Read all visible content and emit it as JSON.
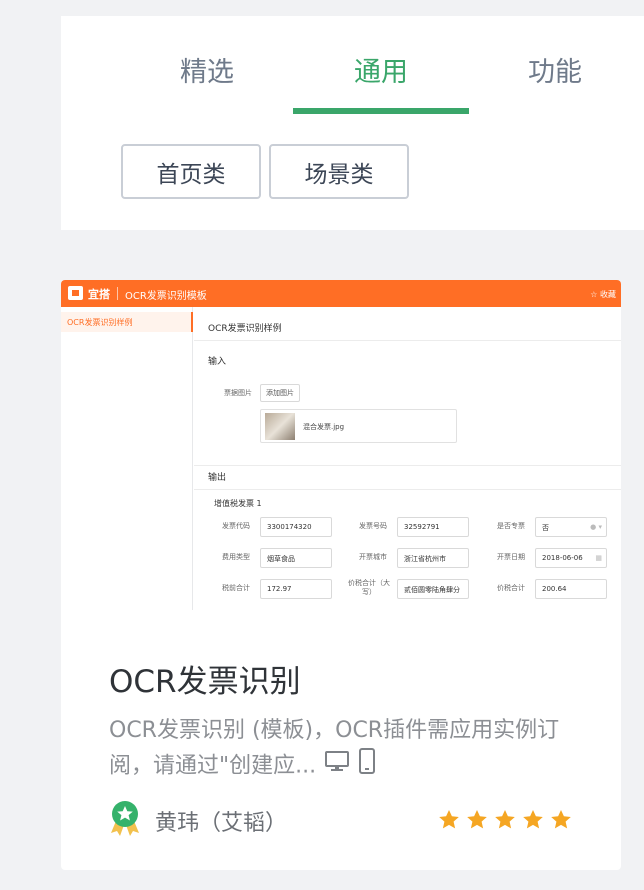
{
  "tabs": [
    {
      "label": "精选",
      "active": false
    },
    {
      "label": "通用",
      "active": true
    },
    {
      "label": "功能",
      "active": false
    }
  ],
  "chips": [
    "首页类",
    "场景类"
  ],
  "colors": {
    "accent": "#3aa66a",
    "preview_brand": "#ff6e25",
    "star": "#f5a623"
  },
  "card": {
    "preview": {
      "brand": "宜搭",
      "app_title": "OCR发票识别模板",
      "favorite": "☆ 收藏",
      "sidebar_item": "OCR发票识别样例",
      "page_heading": "OCR发票识别样例",
      "input_heading": "输入",
      "image_label": "票据图片",
      "add_image_button": "添加图片",
      "file_name": "混合发票.jpg",
      "output_heading": "输出",
      "invoice_heading": "增值税发票 1",
      "fields": {
        "code_label": "发票代码",
        "code_value": "3300174320",
        "number_label": "发票号码",
        "number_value": "32592791",
        "special_label": "是否专票",
        "special_value": "否",
        "type_label": "费用类型",
        "type_value": "烟草食品",
        "city_label": "开票城市",
        "city_value": "浙江省杭州市",
        "date_label": "开票日期",
        "date_value": "2018-06-06",
        "pretax_label": "税前合计",
        "pretax_value": "172.97",
        "total_cn_label": "价税合计（大写）",
        "total_cn_value": "贰佰圆零陆角肆分",
        "total_label": "价税合计",
        "total_value": "200.64"
      }
    },
    "title": "OCR发票识别",
    "description": "OCR发票识别 (模板)，OCR插件需应用实例订阅，请通过\"创建应...",
    "author": "黄玮（艾韬）",
    "rating": 5,
    "icons": [
      "desktop-icon",
      "mobile-icon",
      "award-badge-icon",
      "star-icon"
    ]
  }
}
